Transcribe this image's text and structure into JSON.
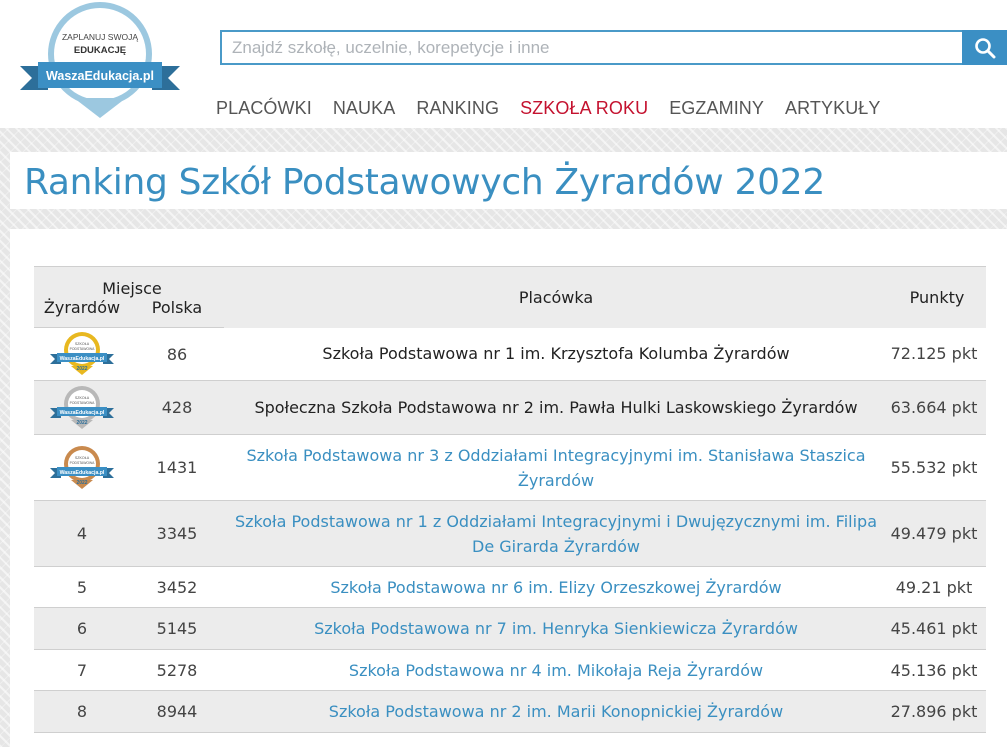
{
  "logo": {
    "line1": "ZAPLANUJ SWOJĄ",
    "line2": "EDUKACJĘ",
    "ribbon": "WaszaEdukacja.pl"
  },
  "search": {
    "placeholder": "Znajdź szkołę, uczelnie, korepetycje i inne",
    "value": "",
    "icon": "search-icon"
  },
  "nav": [
    {
      "label": "PLACÓWKI"
    },
    {
      "label": "NAUKA"
    },
    {
      "label": "RANKING"
    },
    {
      "label": "SZKOŁA ROKU",
      "active": true
    },
    {
      "label": "EGZAMINY"
    },
    {
      "label": "ARTYKUŁY"
    }
  ],
  "colors": {
    "accent": "#3a8fc1",
    "active_nav": "#c4122f",
    "gold": "#e8b820",
    "silver": "#b8b8b8",
    "bronze": "#c98a4e"
  },
  "page_title": "Ranking Szkół Podstawowych Żyrardów 2022",
  "table": {
    "header_group": "Miejsce",
    "col_local": "Żyrardów",
    "col_poland": "Polska",
    "col_school": "Placówka",
    "col_points": "Punkty",
    "badge_text": {
      "top": "SZKOŁA",
      "mid": "PODSTAWOWA",
      "ribbon": "WaszaEdukacja.pl",
      "year": "2022"
    },
    "rows": [
      {
        "badge": "gold",
        "local": "",
        "poland": "86",
        "school_lines": [
          "Szkoła Podstawowa nr 1 im. Krzysztofa Kolumba Żyrardów"
        ],
        "link": false,
        "points": "72.125 pkt"
      },
      {
        "badge": "silver",
        "local": "",
        "poland": "428",
        "school_lines": [
          "Społeczna Szkoła Podstawowa nr 2 im. Pawła Hulki Laskowskiego Żyrardów"
        ],
        "link": false,
        "points": "63.664 pkt"
      },
      {
        "badge": "bronze",
        "local": "",
        "poland": "1431",
        "school_lines": [
          "Szkoła Podstawowa nr 3 z Oddziałami Integracyjnymi im. Stanisława Staszica",
          "Żyrardów"
        ],
        "link": true,
        "points": "55.532 pkt"
      },
      {
        "badge": "",
        "local": "4",
        "poland": "3345",
        "school_lines": [
          "Szkoła Podstawowa nr 1 z Oddziałami Integracyjnymi i Dwujęzycznymi im. Filipa",
          "De Girarda Żyrardów"
        ],
        "link": true,
        "points": "49.479 pkt"
      },
      {
        "badge": "",
        "local": "5",
        "poland": "3452",
        "school_lines": [
          "Szkoła Podstawowa nr 6 im. Elizy Orzeszkowej Żyrardów"
        ],
        "link": true,
        "points": "49.21 pkt"
      },
      {
        "badge": "",
        "local": "6",
        "poland": "5145",
        "school_lines": [
          "Szkoła Podstawowa nr 7 im. Henryka Sienkiewicza Żyrardów"
        ],
        "link": true,
        "points": "45.461 pkt"
      },
      {
        "badge": "",
        "local": "7",
        "poland": "5278",
        "school_lines": [
          "Szkoła Podstawowa nr 4 im. Mikołaja Reja Żyrardów"
        ],
        "link": true,
        "points": "45.136 pkt"
      },
      {
        "badge": "",
        "local": "8",
        "poland": "8944",
        "school_lines": [
          "Szkoła Podstawowa nr 2 im. Marii Konopnickiej Żyrardów"
        ],
        "link": true,
        "points": "27.896 pkt"
      }
    ]
  }
}
